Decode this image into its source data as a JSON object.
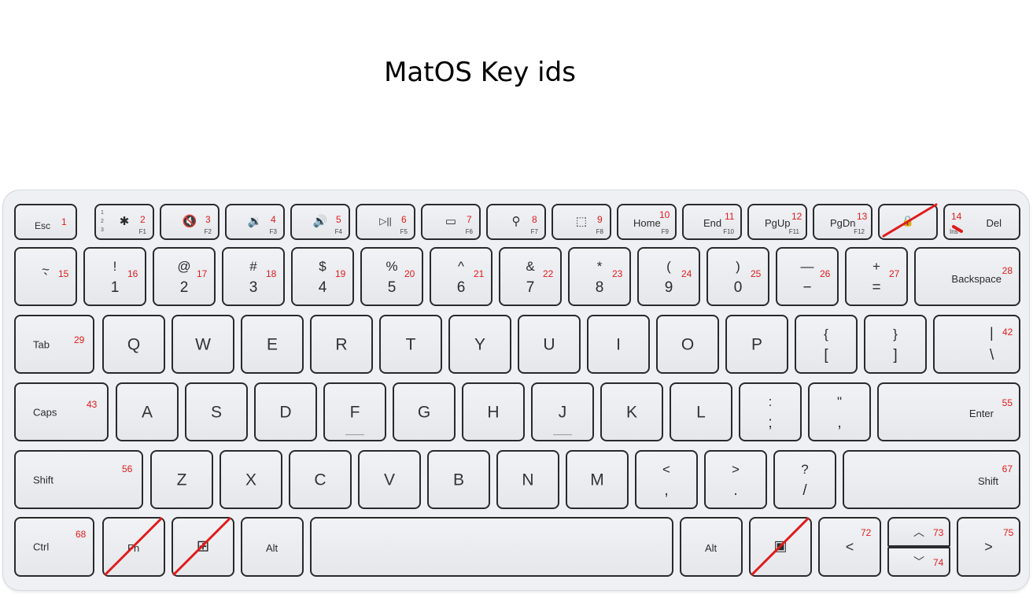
{
  "title": "MatOS Key ids",
  "keys": {
    "esc": {
      "label": "Esc",
      "id": "1"
    },
    "f1": {
      "id": "2",
      "sub": "F1",
      "icon": "✱",
      "dots": [
        "1",
        "2",
        "3"
      ]
    },
    "f2": {
      "id": "3",
      "sub": "F2",
      "icon": "🔇"
    },
    "f3": {
      "id": "4",
      "sub": "F3",
      "icon": "🔉"
    },
    "f4": {
      "id": "5",
      "sub": "F4",
      "icon": "🔊"
    },
    "f5": {
      "id": "6",
      "sub": "F5",
      "icon": "▷||"
    },
    "f6": {
      "id": "7",
      "sub": "F6",
      "icon": "▭"
    },
    "f7": {
      "id": "8",
      "sub": "F7",
      "icon": "⚲"
    },
    "f8": {
      "id": "9",
      "sub": "F8",
      "icon": "⬚"
    },
    "home": {
      "label": "Home",
      "id": "10",
      "sub": "F9"
    },
    "end": {
      "label": "End",
      "id": "11",
      "sub": "F10"
    },
    "pgup": {
      "label": "PgUp",
      "id": "12",
      "sub": "F11"
    },
    "pgdn": {
      "label": "PgDn",
      "id": "13",
      "sub": "F12"
    },
    "lock": {
      "icon": "🔒"
    },
    "del": {
      "label": "Del",
      "id": "14",
      "sub": "Ins"
    },
    "backtick": {
      "top": "~",
      "bot": "`",
      "id": "15"
    },
    "k1": {
      "top": "!",
      "bot": "1",
      "id": "16"
    },
    "k2": {
      "top": "@",
      "bot": "2",
      "id": "17"
    },
    "k3": {
      "top": "#",
      "bot": "3",
      "id": "18"
    },
    "k4": {
      "top": "$",
      "bot": "4",
      "id": "19"
    },
    "k5": {
      "top": "%",
      "bot": "5",
      "id": "20"
    },
    "k6": {
      "top": "^",
      "bot": "6",
      "id": "21"
    },
    "k7": {
      "top": "&",
      "bot": "7",
      "id": "22"
    },
    "k8": {
      "top": "*",
      "bot": "8",
      "id": "23"
    },
    "k9": {
      "top": "(",
      "bot": "9",
      "id": "24"
    },
    "k0": {
      "top": ")",
      "bot": "0",
      "id": "25"
    },
    "minus": {
      "top": "—",
      "bot": "−",
      "id": "26"
    },
    "equal": {
      "top": "+",
      "bot": "=",
      "id": "27"
    },
    "backspace": {
      "label": "Backspace",
      "id": "28"
    },
    "tab": {
      "label": "Tab",
      "id": "29"
    },
    "q": {
      "label": "Q"
    },
    "w": {
      "label": "W"
    },
    "e": {
      "label": "E"
    },
    "r": {
      "label": "R"
    },
    "t": {
      "label": "T"
    },
    "y": {
      "label": "Y"
    },
    "u": {
      "label": "U"
    },
    "i": {
      "label": "I"
    },
    "o": {
      "label": "O"
    },
    "p": {
      "label": "P"
    },
    "lbracket": {
      "top": "{",
      "bot": "["
    },
    "rbracket": {
      "top": "}",
      "bot": "]"
    },
    "backslash": {
      "top": "|",
      "bot": "\\",
      "id": "42"
    },
    "caps": {
      "label": "Caps",
      "id": "43"
    },
    "a": {
      "label": "A"
    },
    "s": {
      "label": "S"
    },
    "d": {
      "label": "D"
    },
    "f": {
      "label": "F"
    },
    "g": {
      "label": "G"
    },
    "h": {
      "label": "H"
    },
    "j": {
      "label": "J"
    },
    "k": {
      "label": "K"
    },
    "l": {
      "label": "L"
    },
    "semicolon": {
      "top": ":",
      "bot": ";"
    },
    "quote": {
      "top": "\"",
      "bot": ","
    },
    "enter": {
      "label": "Enter",
      "id": "55"
    },
    "lshift": {
      "label": "Shift",
      "id": "56"
    },
    "z": {
      "label": "Z"
    },
    "x": {
      "label": "X"
    },
    "c": {
      "label": "C"
    },
    "v": {
      "label": "V"
    },
    "b": {
      "label": "B"
    },
    "n": {
      "label": "N"
    },
    "m": {
      "label": "M"
    },
    "comma": {
      "top": "<",
      "bot": ","
    },
    "period": {
      "top": ">",
      "bot": "."
    },
    "slash": {
      "top": "?",
      "bot": "/"
    },
    "rshift": {
      "label": "Shift",
      "id": "67"
    },
    "ctrl": {
      "label": "Ctrl",
      "id": "68"
    },
    "fn": {
      "label": "Fn"
    },
    "win": {
      "icon": "⊞"
    },
    "lalt": {
      "label": "Alt"
    },
    "space": {
      "label": ""
    },
    "ralt": {
      "label": "Alt"
    },
    "copilot": {
      "icon": "▣"
    },
    "left": {
      "label": "<",
      "id": "72"
    },
    "up": {
      "label": "︿",
      "id": "73"
    },
    "down": {
      "label": "﹀",
      "id": "74"
    },
    "right": {
      "label": ">",
      "id": "75"
    }
  },
  "annotation_color": "#e01b1b",
  "key_color": "#eceef2",
  "crossed_out_keys": [
    "lock",
    "del",
    "fn",
    "win",
    "copilot"
  ]
}
